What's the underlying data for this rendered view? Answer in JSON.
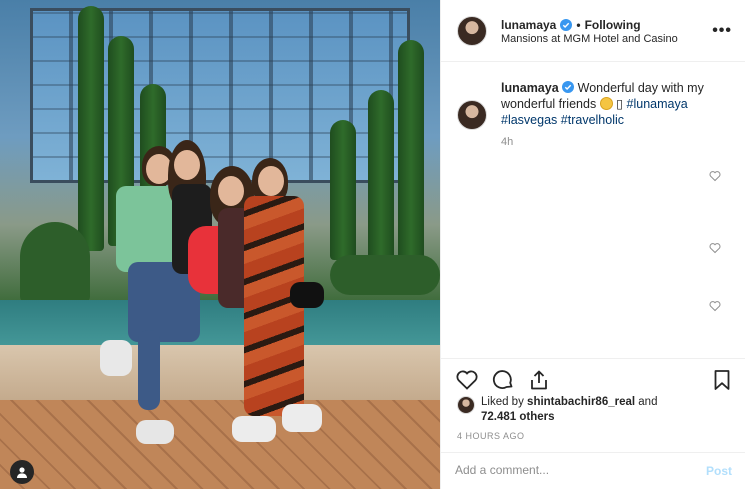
{
  "header": {
    "username": "lunamaya",
    "separator": "•",
    "follow_status": "Following",
    "location": "Mansions at MGM Hotel and Casino",
    "more_icon": "ellipsis-icon"
  },
  "caption": {
    "username": "lunamaya",
    "text": "Wonderful day with my wonderful friends",
    "trailing": "▯",
    "hashtags": [
      "#lunamaya",
      "#lasvegas",
      "#travelholic"
    ],
    "time": "4h"
  },
  "likes": {
    "prefix": "Liked by",
    "user": "shintabachir86_real",
    "joiner": "and",
    "count": "72.481 others"
  },
  "post_age": "4 HOURS AGO",
  "comment": {
    "placeholder": "Add a comment...",
    "post_label": "Post"
  },
  "colors": {
    "verified": "#3897f0",
    "hashtag": "#00376b",
    "post_disabled": "#b2dffc"
  }
}
